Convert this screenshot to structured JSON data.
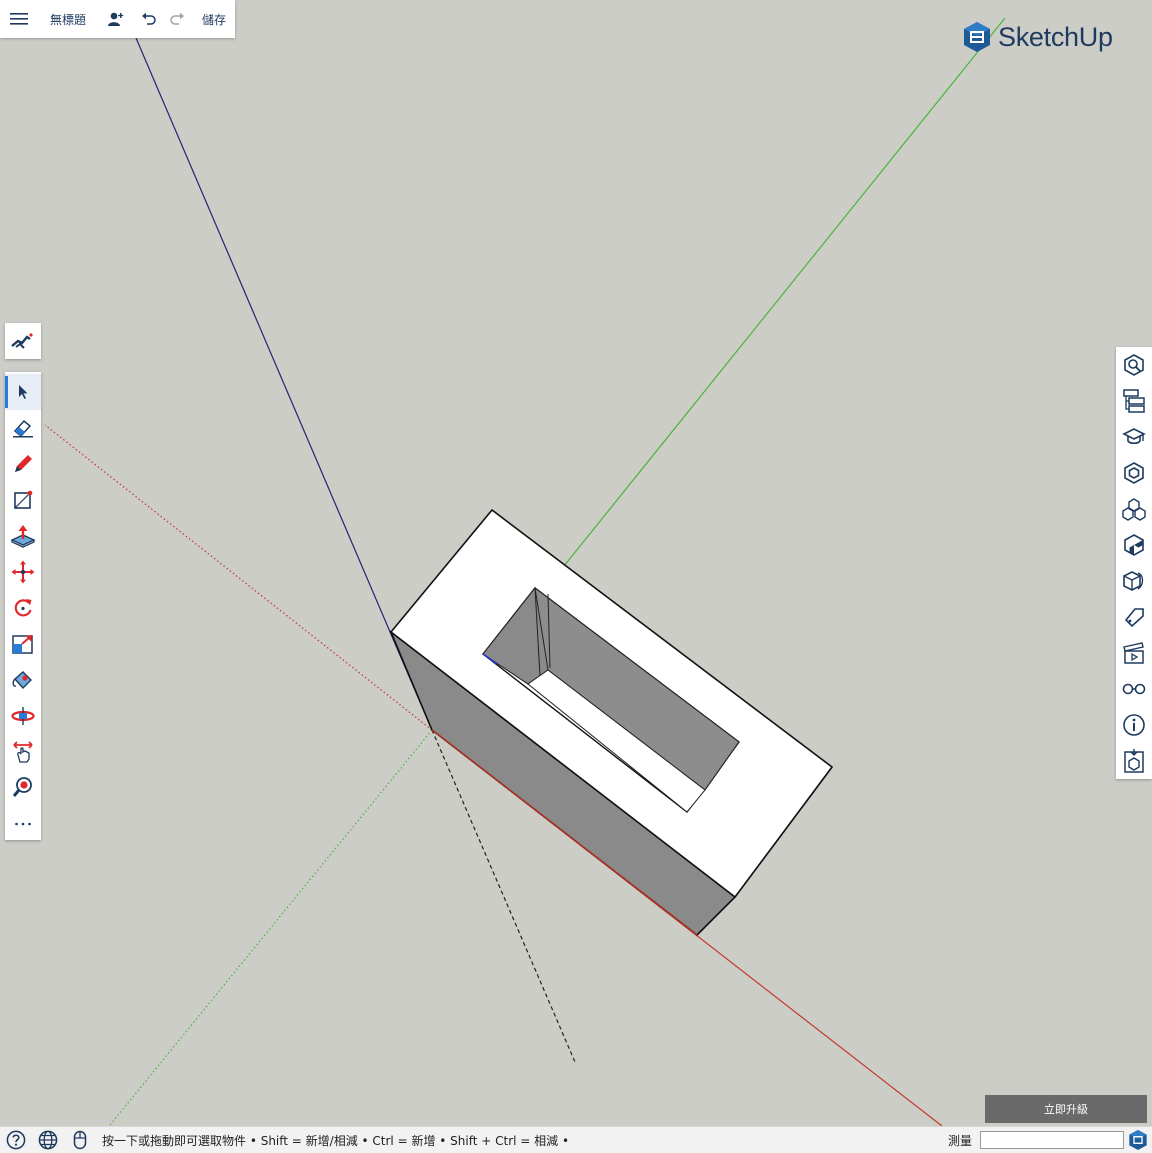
{
  "app": {
    "brand": "SketchUp",
    "document_title": "無標題",
    "save_label": "儲存"
  },
  "icons": {
    "menu": "hamburger-icon",
    "user": "add-user-icon",
    "undo": "undo-icon",
    "redo": "redo-icon",
    "search": "search-tools-icon",
    "help": "help-icon",
    "globe": "globe-icon",
    "mouse": "mouse-icon"
  },
  "left_toolbar": {
    "tools": [
      {
        "name": "select",
        "icon": "select-arrow-icon",
        "active": true
      },
      {
        "name": "eraser",
        "icon": "eraser-icon"
      },
      {
        "name": "pencil",
        "icon": "pencil-icon"
      },
      {
        "name": "rectangle",
        "icon": "rectangle-icon"
      },
      {
        "name": "push-pull",
        "icon": "push-pull-icon"
      },
      {
        "name": "move",
        "icon": "move-icon"
      },
      {
        "name": "rotate",
        "icon": "rotate-icon"
      },
      {
        "name": "scale",
        "icon": "scale-icon"
      },
      {
        "name": "paint",
        "icon": "paint-bucket-icon"
      },
      {
        "name": "orbit",
        "icon": "orbit-icon"
      },
      {
        "name": "pan",
        "icon": "pan-hand-icon"
      },
      {
        "name": "zoom",
        "icon": "zoom-icon"
      },
      {
        "name": "more",
        "icon": "more-dots-icon"
      }
    ]
  },
  "right_panel": {
    "items": [
      {
        "name": "entity-info",
        "icon": "entity-info-icon"
      },
      {
        "name": "outliner",
        "icon": "outliner-icon"
      },
      {
        "name": "instructor",
        "icon": "instructor-icon"
      },
      {
        "name": "components",
        "icon": "components-icon"
      },
      {
        "name": "tags",
        "icon": "tags-icon"
      },
      {
        "name": "materials",
        "icon": "materials-icon"
      },
      {
        "name": "styles",
        "icon": "styles-icon"
      },
      {
        "name": "tag",
        "icon": "tag-icon"
      },
      {
        "name": "scenes",
        "icon": "scenes-icon"
      },
      {
        "name": "display",
        "icon": "glasses-icon"
      },
      {
        "name": "model-info",
        "icon": "info-icon"
      },
      {
        "name": "3d-warehouse",
        "icon": "warehouse-icon"
      }
    ]
  },
  "upgrade": {
    "label": "立即升級"
  },
  "status": {
    "hint": "按一下或拖動即可選取物件 • Shift = 新增/相減 • Ctrl = 新增 • Shift + Ctrl = 相減 •",
    "measure_label": "測量",
    "measure_value": ""
  },
  "colors": {
    "brand": "#1e3a5f",
    "accent": "#2a7bd6",
    "tool_red": "#e0282c",
    "axis_red": "#cc3322",
    "axis_green": "#44bb33",
    "axis_blue": "#222288",
    "canvas": "#cdcdc8"
  }
}
